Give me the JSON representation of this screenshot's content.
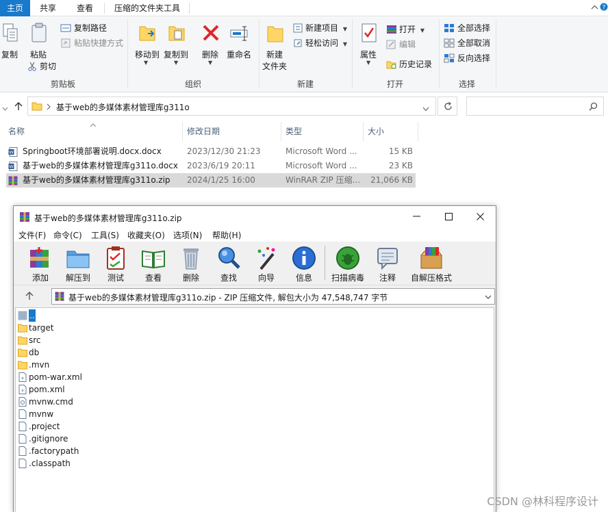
{
  "explorer": {
    "tabs": [
      {
        "label": "主页",
        "active": true
      },
      {
        "label": "共享",
        "active": false
      },
      {
        "label": "查看",
        "active": false
      },
      {
        "label": "压缩的文件夹工具",
        "active": false
      }
    ],
    "ribbon": {
      "clipboard": {
        "group_label": "剪贴板",
        "copy": "复制",
        "paste": "粘贴",
        "copy_path": "复制路径",
        "paste_shortcut": "粘贴快捷方式",
        "cut": "剪切"
      },
      "organize": {
        "group_label": "组织",
        "move_to": "移动到",
        "copy_to": "复制到",
        "delete": "删除",
        "rename": "重命名"
      },
      "new": {
        "group_label": "新建",
        "new_folder_line1": "新建",
        "new_folder_line2": "文件夹",
        "new_item": "新建项目",
        "easy_access": "轻松访问"
      },
      "open": {
        "group_label": "打开",
        "properties": "属性",
        "open": "打开",
        "edit": "编辑",
        "history": "历史记录"
      },
      "select": {
        "group_label": "选择",
        "select_all": "全部选择",
        "select_none": "全部取消",
        "invert": "反向选择"
      }
    },
    "address": {
      "path": "基于web的多媒体素材管理库g311o",
      "search_placeholder": ""
    },
    "columns": [
      "名称",
      "修改日期",
      "类型",
      "大小"
    ],
    "files": [
      {
        "name": "Springboot环境部署说明.docx.docx",
        "date": "2023/12/30 21:23",
        "type": "Microsoft Word ...",
        "size": "15 KB",
        "icon": "word-icon",
        "selected": false
      },
      {
        "name": "基于web的多媒体素材管理库g311o.docx",
        "date": "2023/6/19 20:11",
        "type": "Microsoft Word ...",
        "size": "23 KB",
        "icon": "word-icon",
        "selected": false
      },
      {
        "name": "基于web的多媒体素材管理库g311o.zip",
        "date": "2024/1/25 16:00",
        "type": "WinRAR ZIP 压缩...",
        "size": "21,066 KB",
        "icon": "winrar-icon",
        "selected": true
      }
    ]
  },
  "winrar": {
    "title": "基于web的多媒体素材管理库g311o.zip",
    "menu": [
      "文件(F)",
      "命令(C)",
      "工具(S)",
      "收藏夹(O)",
      "选项(N)",
      "帮助(H)"
    ],
    "toolbar": [
      "添加",
      "解压到",
      "测试",
      "查看",
      "删除",
      "查找",
      "向导",
      "信息",
      "扫描病毒",
      "注释",
      "自解压格式"
    ],
    "path_text": "基于web的多媒体素材管理库g311o.zip - ZIP 压缩文件, 解包大小为 47,548,747 字节",
    "entries": [
      {
        "name": "..",
        "kind": "parent",
        "selected": true
      },
      {
        "name": "target",
        "kind": "folder"
      },
      {
        "name": "src",
        "kind": "folder"
      },
      {
        "name": "db",
        "kind": "folder"
      },
      {
        "name": ".mvn",
        "kind": "folder"
      },
      {
        "name": "pom-war.xml",
        "kind": "xml"
      },
      {
        "name": "pom.xml",
        "kind": "xml"
      },
      {
        "name": "mvnw.cmd",
        "kind": "cmd"
      },
      {
        "name": "mvnw",
        "kind": "file"
      },
      {
        "name": ".project",
        "kind": "file"
      },
      {
        "name": ".gitignore",
        "kind": "file"
      },
      {
        "name": ".factorypath",
        "kind": "file"
      },
      {
        "name": ".classpath",
        "kind": "file"
      }
    ]
  },
  "watermark": "CSDN @林科程序设计",
  "colors": {
    "accent": "#1979ca",
    "selected_row": "#d9d9d9",
    "folder": "#ffd666",
    "ribbon_bg": "#f5f6f7"
  }
}
